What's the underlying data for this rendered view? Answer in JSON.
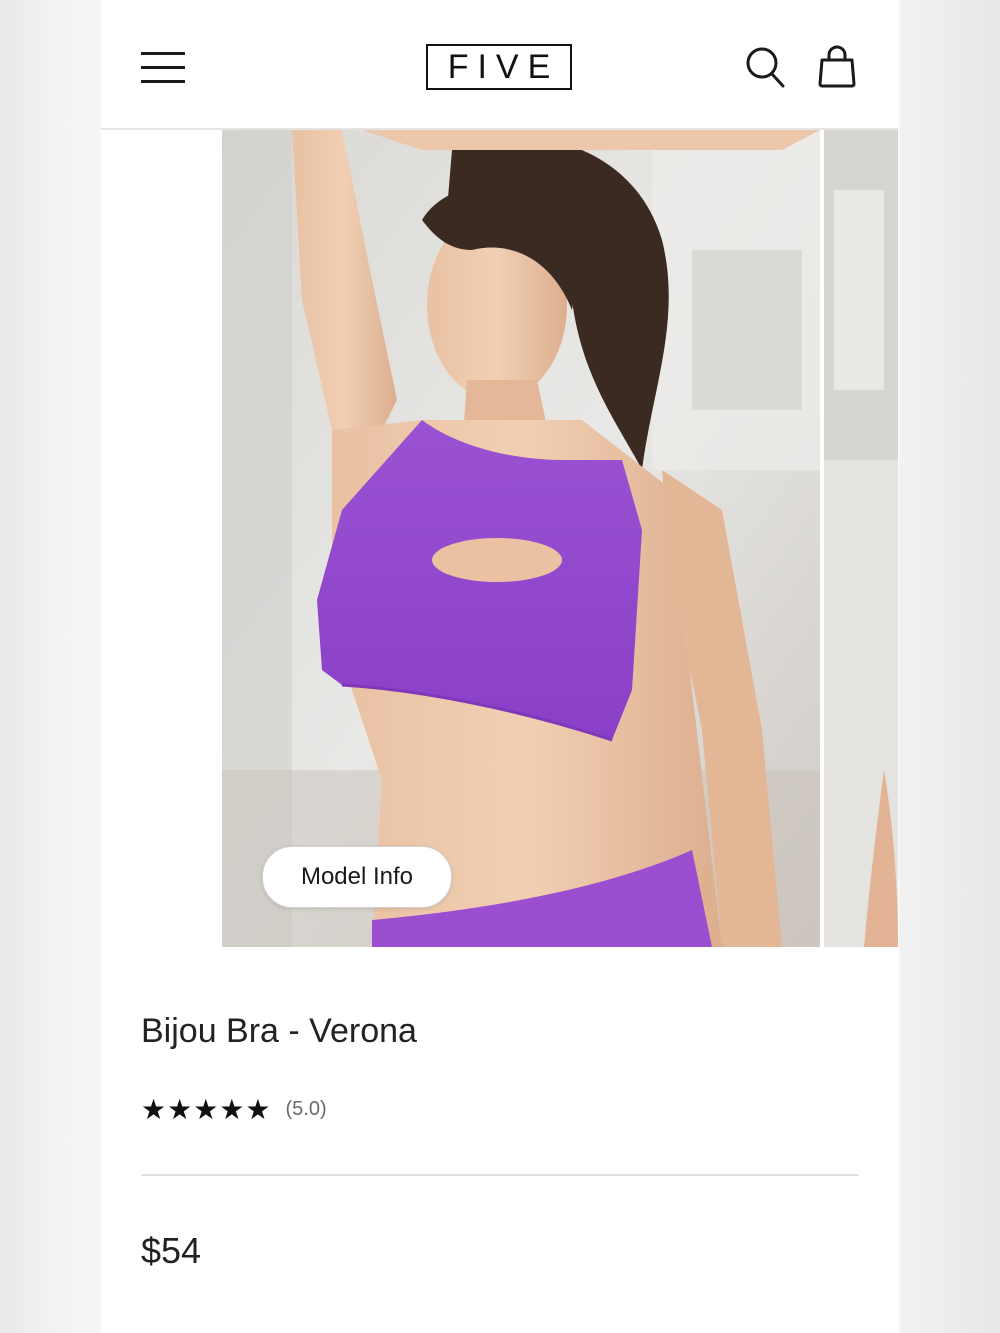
{
  "header": {
    "logo": "FIVE",
    "menu_icon": "hamburger-menu-icon",
    "search_icon": "search-icon",
    "cart_icon": "shopping-bag-icon"
  },
  "gallery": {
    "model_info_label": "Model Info",
    "top_color": "#9b4fd0"
  },
  "product": {
    "title": "Bijou Bra - Verona",
    "stars": "★★★★★",
    "rating": "(5.0)",
    "price": "$54"
  }
}
